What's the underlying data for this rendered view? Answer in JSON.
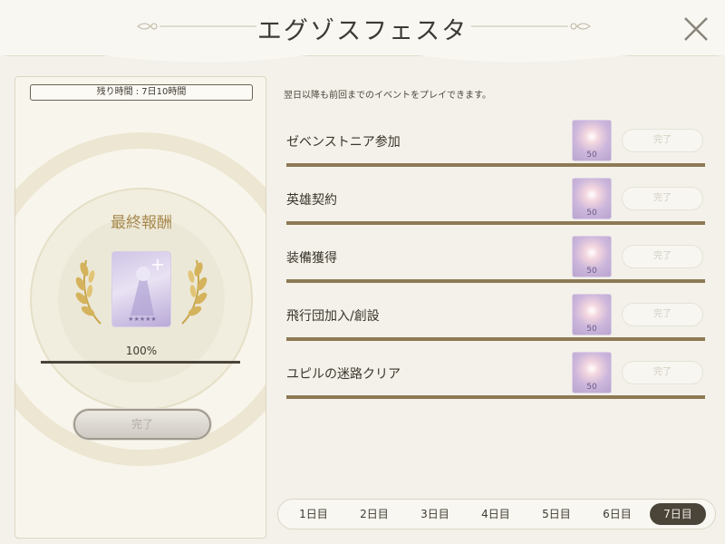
{
  "header": {
    "title": "エグゾスフェスタ"
  },
  "left": {
    "remaining_time": "残り時間 : 7日10時間",
    "final_reward_title": "最終報酬",
    "progress_percent": 100,
    "progress_text": "100%",
    "complete_label": "完了"
  },
  "right": {
    "subtitle": "翌日以降も前回までのイベントをプレイできます。",
    "missions": [
      {
        "name": "ゼベンストニア参加",
        "reward_count": "50",
        "button": "完了"
      },
      {
        "name": "英雄契約",
        "reward_count": "50",
        "button": "完了"
      },
      {
        "name": "装備獲得",
        "reward_count": "50",
        "button": "完了"
      },
      {
        "name": "飛行団加入/創設",
        "reward_count": "50",
        "button": "完了"
      },
      {
        "name": "ユピルの迷路クリア",
        "reward_count": "50",
        "button": "完了"
      }
    ]
  },
  "days": {
    "tabs": [
      "1日目",
      "2日目",
      "3日目",
      "4日目",
      "5日目",
      "6日目",
      "7日目"
    ],
    "selected_index": 6
  },
  "colors": {
    "accent_dark": "#4a4439",
    "gold": "#a88a4e",
    "mission_line": "#8d7a55"
  }
}
